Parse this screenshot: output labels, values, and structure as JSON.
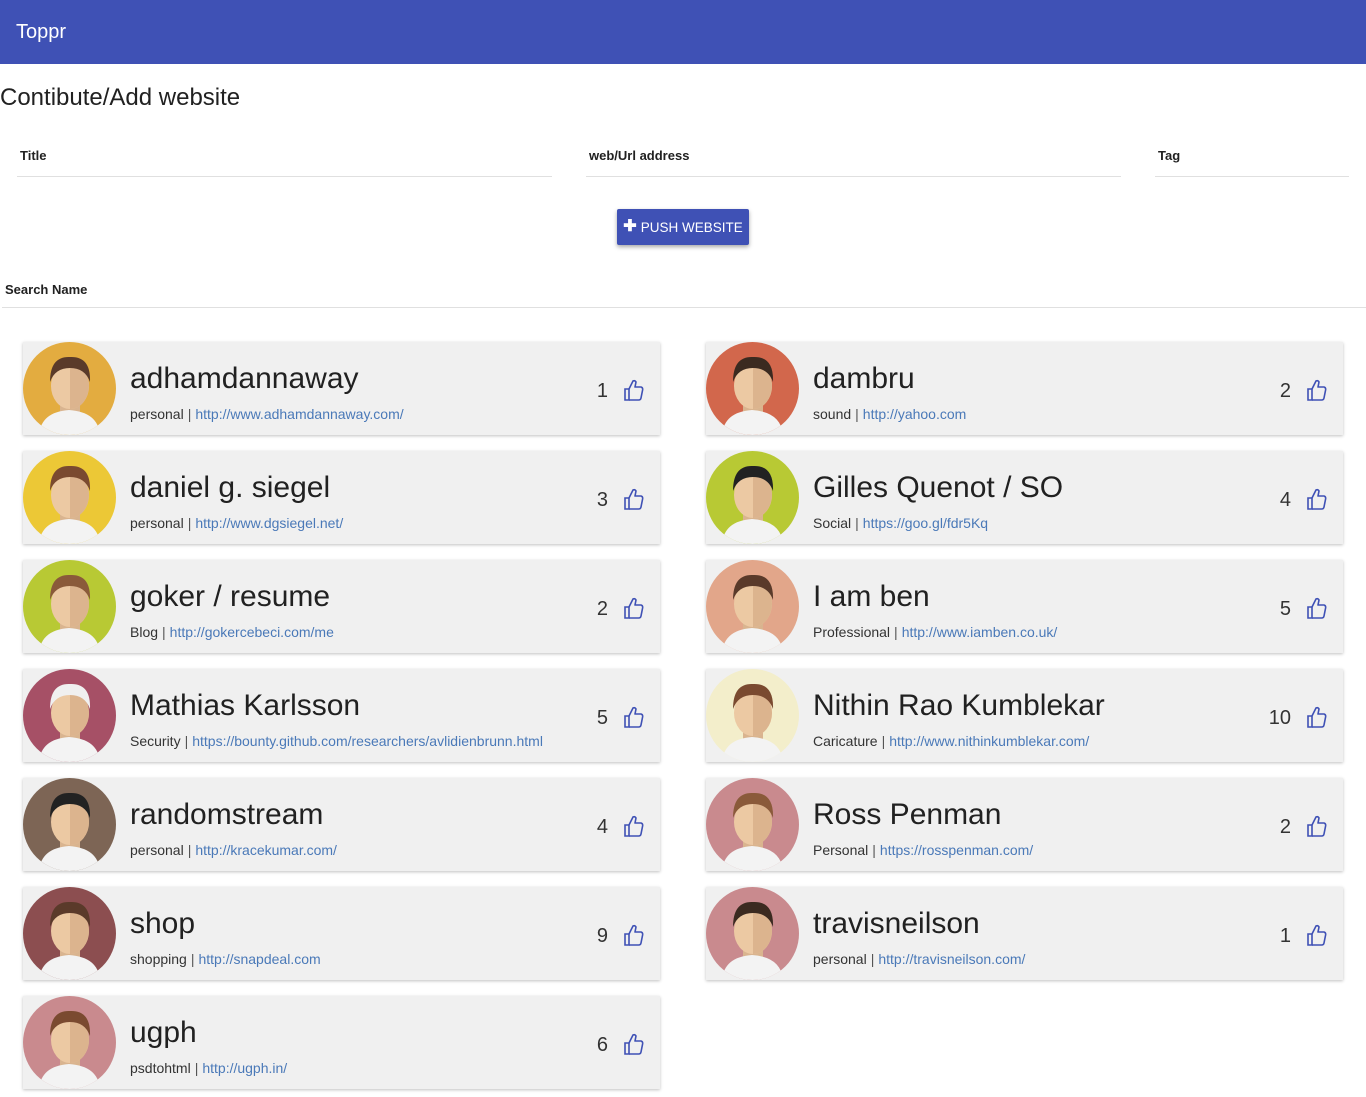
{
  "app": {
    "title": "Toppr",
    "accent": "#3f51b5"
  },
  "form": {
    "heading": "Contibute/Add website",
    "title_placeholder": "Title",
    "url_placeholder": "web/Url address",
    "tag_placeholder": "Tag",
    "push_label": "PUSH WEBSITE"
  },
  "search": {
    "placeholder": "Search Name"
  },
  "cards": [
    {
      "name": "adhamdannaway",
      "tag": "personal",
      "url": "http://www.adhamdannaway.com/",
      "likes": "1",
      "avatar_bg": "#e3ac40"
    },
    {
      "name": "dambru",
      "tag": "sound",
      "url": "http://yahoo.com",
      "likes": "2",
      "avatar_bg": "#d2674c"
    },
    {
      "name": "daniel g. siegel",
      "tag": "personal",
      "url": "http://www.dgsiegel.net/",
      "likes": "3",
      "avatar_bg": "#ecc836"
    },
    {
      "name": "Gilles Quenot / SO",
      "tag": "Social",
      "url": "https://goo.gl/fdr5Kq",
      "likes": "4",
      "avatar_bg": "#b8c934"
    },
    {
      "name": "goker / resume",
      "tag": "Blog",
      "url": "http://gokercebeci.com/me",
      "likes": "2",
      "avatar_bg": "#b8c934"
    },
    {
      "name": "I am ben",
      "tag": "Professional",
      "url": "http://www.iamben.co.uk/",
      "likes": "5",
      "avatar_bg": "#e2a68a"
    },
    {
      "name": "Mathias Karlsson",
      "tag": "Security",
      "url": "https://bounty.github.com/researchers/avlidienbrunn.html",
      "likes": "5",
      "avatar_bg": "#a65066"
    },
    {
      "name": "Nithin Rao Kumblekar",
      "tag": "Caricature",
      "url": "http://www.nithinkumblekar.com/",
      "likes": "10",
      "avatar_bg": "#f3eecb"
    },
    {
      "name": "randomstream",
      "tag": "personal",
      "url": "http://kracekumar.com/",
      "likes": "4",
      "avatar_bg": "#7d6555"
    },
    {
      "name": "Ross Penman",
      "tag": "Personal",
      "url": "https://rosspenman.com/",
      "likes": "2",
      "avatar_bg": "#c98a8e"
    },
    {
      "name": "shop",
      "tag": "shopping",
      "url": "http://snapdeal.com",
      "likes": "9",
      "avatar_bg": "#8c4e50"
    },
    {
      "name": "travisneilson",
      "tag": "personal",
      "url": "http://travisneilson.com/",
      "likes": "1",
      "avatar_bg": "#c98a8e"
    },
    {
      "name": "ugph",
      "tag": "psdtohtml",
      "url": "http://ugph.in/",
      "likes": "6",
      "avatar_bg": "#c98a8e"
    }
  ]
}
